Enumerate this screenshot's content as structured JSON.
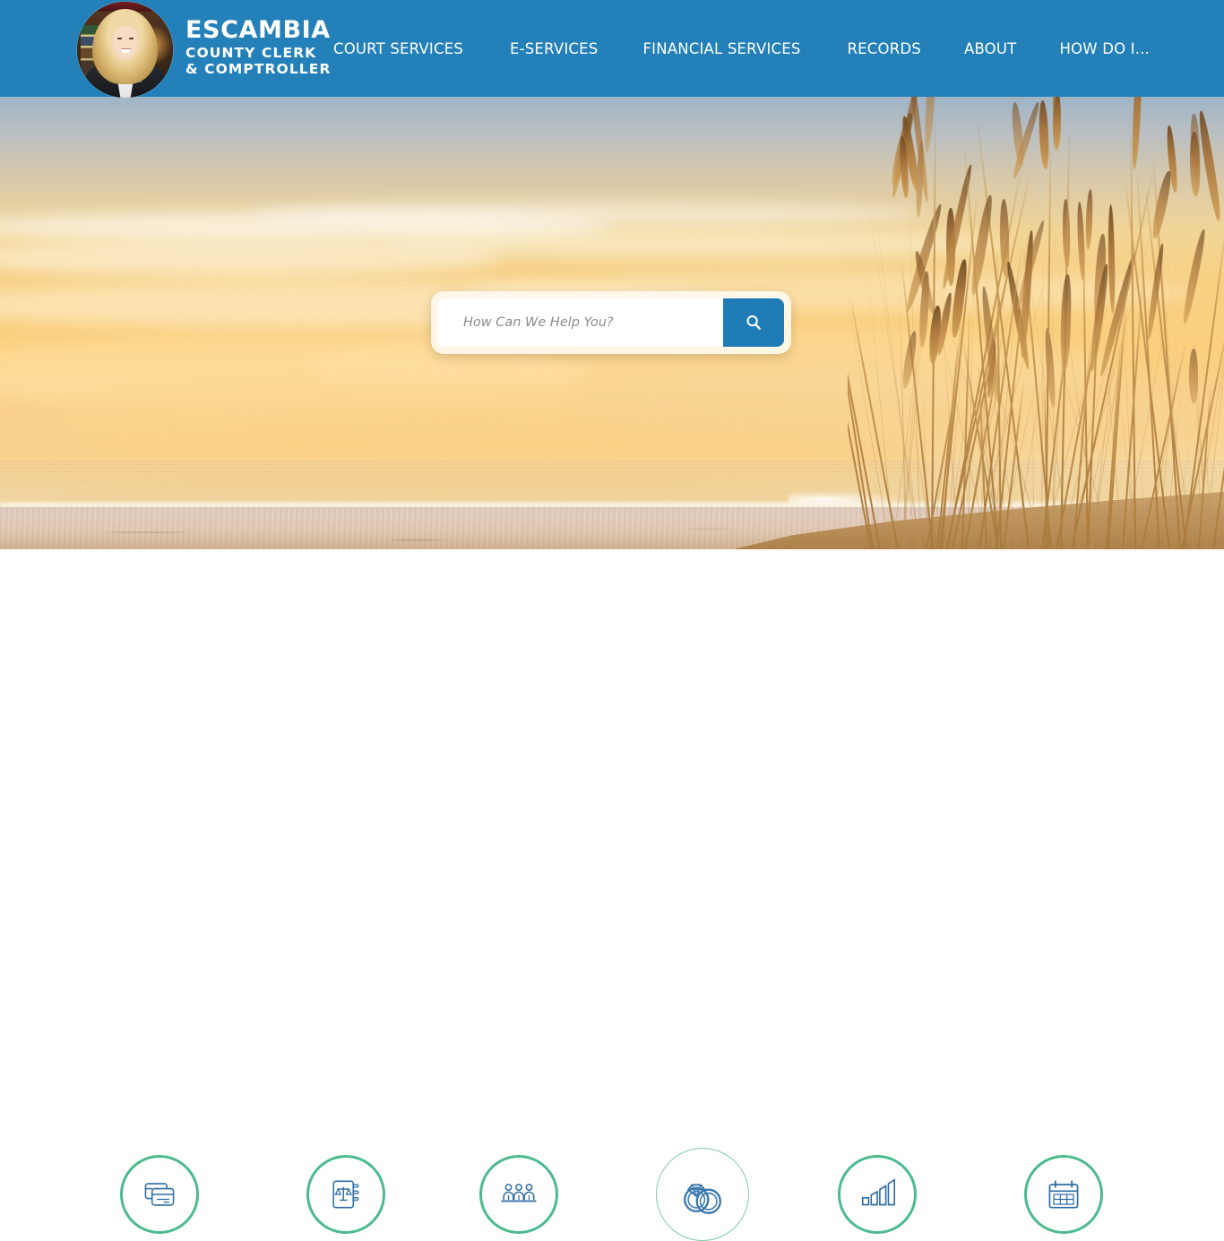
{
  "header": {
    "background_color": "#2380b8",
    "brand": {
      "portrait_alt": "clerk-portrait",
      "line1": "ESCAMBIA",
      "line2": "COUNTY CLERK",
      "line3": "& COMPTROLLER"
    },
    "nav": [
      {
        "label": "COURT SERVICES",
        "name": "nav-court-services"
      },
      {
        "label": "E-SERVICES",
        "name": "nav-e-services"
      },
      {
        "label": "FINANCIAL SERVICES",
        "name": "nav-financial-services"
      },
      {
        "label": "RECORDS",
        "name": "nav-records"
      },
      {
        "label": "ABOUT",
        "name": "nav-about"
      },
      {
        "label": "HOW DO I...",
        "name": "nav-how-do-i"
      }
    ]
  },
  "hero": {
    "image_description": "Sunset beach with sea oats",
    "search": {
      "placeholder": "How Can We Help You?",
      "value": "",
      "button_icon": "search-icon",
      "button_color": "#1f7cb7"
    }
  },
  "quicklinks": {
    "ring_color": "#4cba8c",
    "icon_color": "#2e6da4",
    "items": [
      {
        "icon": "credit-cards-icon",
        "name": "quicklink-pay-online",
        "hovered": false
      },
      {
        "icon": "law-book-scales-icon",
        "name": "quicklink-court-records",
        "hovered": false
      },
      {
        "icon": "jury-people-icon",
        "name": "quicklink-jury-duty",
        "hovered": false
      },
      {
        "icon": "wedding-rings-icon",
        "name": "quicklink-marriage-license",
        "hovered": true
      },
      {
        "icon": "bar-chart-growth-icon",
        "name": "quicklink-financial-reports",
        "hovered": false
      },
      {
        "icon": "calendar-icon",
        "name": "quicklink-calendar",
        "hovered": false
      }
    ]
  }
}
